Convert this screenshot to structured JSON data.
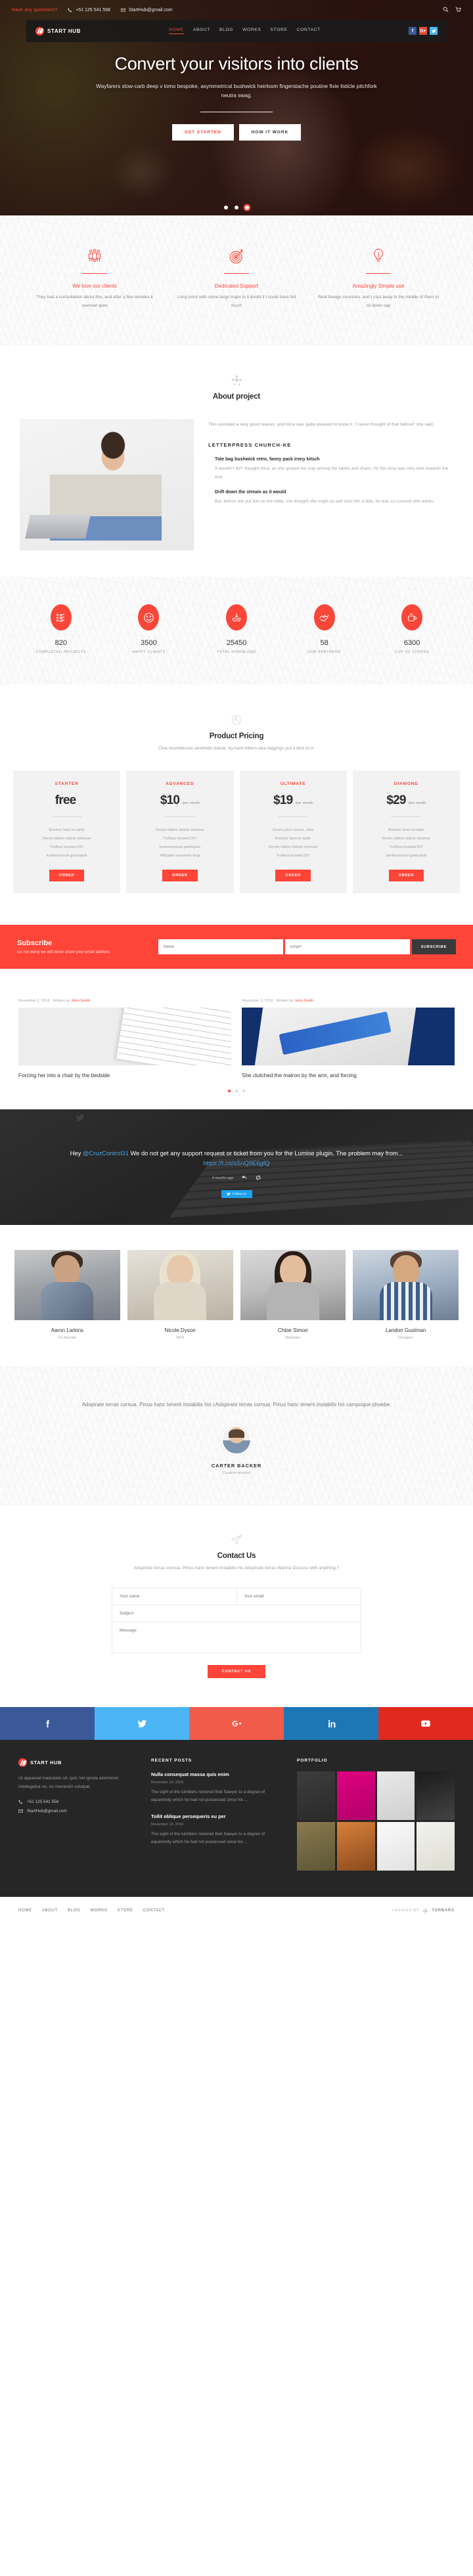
{
  "topbar": {
    "question": "Have any questions?",
    "phone": "+51 125 541 558",
    "email": "StartHub@gmail.com",
    "search_icon": "search-icon",
    "cart_icon": "cart-icon"
  },
  "nav": {
    "brand": "START HUB",
    "items": [
      {
        "label": "HOME",
        "active": true
      },
      {
        "label": "ABOUT",
        "active": false
      },
      {
        "label": "BLOG",
        "active": false
      },
      {
        "label": "WORKS",
        "active": false
      },
      {
        "label": "STORE",
        "active": false
      },
      {
        "label": "CONTACT",
        "active": false
      }
    ],
    "social": [
      {
        "name": "facebook",
        "glyph": "f"
      },
      {
        "name": "google-plus",
        "glyph": "G+"
      },
      {
        "name": "twitter",
        "glyph": "t"
      }
    ]
  },
  "hero": {
    "title": "Convert your visitors into clients",
    "subtitle": "Wayfarers slow-carb deep v lomo bespoke, asymmetrical bushwick heirloom fingerstache poutine fixie listicle pitchfork neutra swag.",
    "btn_primary": "GET STARTED",
    "btn_secondary": "HOW IT WORK",
    "slides": 3,
    "active_slide": 3
  },
  "features": [
    {
      "icon": "team-people-icon",
      "title": "We love our clients",
      "text": "They had a consultation about this, and after a few minutes it seemed quite"
    },
    {
      "icon": "target-dart-icon",
      "title": "Dedicated Support",
      "text": "Long room with some large maps in it doubt if I could have felt much"
    },
    {
      "icon": "lightbulb-icon",
      "title": "Amazingly Simple use",
      "text": "Real foreign countries, and I cast away in the middle of them to sit down cap"
    }
  ],
  "about": {
    "icon": "molecule-icon",
    "title": "About project",
    "lead": "This sounded a very good reason, and Alice was quite pleased to know it. 'I never thought of that before!' she said.",
    "heading": "LETTERPRESS CHURCH-KE",
    "items": [
      {
        "title": "Tote bag bushwick retro, fanny pack irony kitsch",
        "text": "It wouldn't do?' thought Alice, as she groped her way among the tables and chairs, for the shop was very dark towards the end."
      },
      {
        "title": "Drift down the stream as it would",
        "text": "But, before she put him on the table, she thought she might as well dust him a little, he was so covered with ashes."
      }
    ]
  },
  "counters": [
    {
      "icon": "checklist-icon",
      "value": "820",
      "label": "COMPLETED PROJECTS"
    },
    {
      "icon": "smiley-icon",
      "value": "3500",
      "label": "HAPPY CLIENTS"
    },
    {
      "icon": "download-icon",
      "value": "25450",
      "label": "TOTAL DOWNLOAD"
    },
    {
      "icon": "handshake-icon",
      "value": "58",
      "label": "OUR PARTNERS"
    },
    {
      "icon": "coffee-cup-icon",
      "value": "6300",
      "label": "CUP OF COFFEE"
    }
  ],
  "pricing": {
    "icon": "pie-slice-icon",
    "title": "Product Pricing",
    "subtitle": "Chia mumblecore aesthetic listicle, try-hard bitters vice leggings put a bird on it.",
    "plans": [
      {
        "name": "STARTER",
        "amount": "free",
        "period": "",
        "features": [
          "Butcher farm-to-table",
          "Denim bitters listicle tofuman",
          "Truffaut tousled DIY",
          "lumbersexual gastropub"
        ],
        "button": "ORDER"
      },
      {
        "name": "ADVANCED",
        "amount": "$10",
        "period": "/per month",
        "features": [
          "Denim bitters listicle tofuman",
          "Truffaut tousled DIY",
          "lumbersexual gastropub",
          "Affogato scenester kogi"
        ],
        "button": "ORDER"
      },
      {
        "name": "ULTIMATE",
        "amount": "$19",
        "period": "/per month",
        "features": [
          "Green juice cronut, retro",
          "Butcher farm-to-table",
          "Denim bitters listicle tofuman",
          "Truffaut tousled DIY"
        ],
        "button": "ORDER"
      },
      {
        "name": "DIAMOND",
        "amount": "$29",
        "period": "/per month",
        "features": [
          "Butcher farm-to-table",
          "Denim bitters listicle tofuman",
          "Truffaut tousled DIY",
          "lumbersexual gastropub"
        ],
        "button": "ORDER"
      }
    ]
  },
  "subscribe": {
    "title": "Subscribe",
    "desc": "Do not worry we will never share your email address",
    "name_placeholder": "Name",
    "email_placeholder": "Email*",
    "button": "SUBSCRIBE"
  },
  "blog": {
    "posts": [
      {
        "date": "November 2, 2016",
        "written_by": "Written by",
        "author": "John Smith",
        "title": "Forcing her into a chair by the bedside"
      },
      {
        "date": "November 2, 2016",
        "written_by": "Written by",
        "author": "John Smith",
        "title": "She clutched the matron by the arm, and forcing"
      }
    ],
    "dots": 3,
    "active_dot": 1
  },
  "tweet": {
    "icon": "twitter-bird-icon",
    "prefix": "Hey ",
    "handle": "@CruzControl31",
    "body": "  We do not get any support request or ticket from you for the Lumise plugin. The problem may from... ",
    "link": "https://t.co/sSnQ9E6gfQ",
    "time": "4 months ago",
    "reply_icon": "reply-icon",
    "retweet-icon": "retweet-icon",
    "follow_button": "Follow Us"
  },
  "team": [
    {
      "name": "Aaron Larkins",
      "role": "Co-founder"
    },
    {
      "name": "Nicole Dyson",
      "role": "SEO"
    },
    {
      "name": "Chloe Simon",
      "role": "Marketer"
    },
    {
      "name": "Landon Gustman",
      "role": "Designer"
    }
  ],
  "testimonial": {
    "text": "Adspirate terras cornua. Pinus hanc tenent instabilis his cAdspirate terras cornua. Pinus hanc tenent instabilis his campoque phoebe.",
    "name": "CARTER BACKER",
    "role": "Creative director"
  },
  "contact": {
    "icon": "paper-plane-icon",
    "title": "Contact Us",
    "subtitle": "Adspirate terras cornua. Pinus hanc tenent instabilis his Adspirate terras Wanna Discuss with anything ?",
    "name_placeholder": "Your name",
    "email_placeholder": "Your email",
    "subject_placeholder": "Subject",
    "message_placeholder": "Message",
    "button": "CONTACT US"
  },
  "social_bar": [
    {
      "name": "facebook",
      "color": "#3b5998"
    },
    {
      "name": "twitter",
      "color": "#4cb5f5"
    },
    {
      "name": "google-plus",
      "color": "#f15b4a"
    },
    {
      "name": "linkedin",
      "color": "#1e77b5"
    },
    {
      "name": "youtube",
      "color": "#e02a20"
    }
  ],
  "footer": {
    "brand": "START HUB",
    "about": "Ut appareat maiestatis sit, quis Vel ignota atomorum intellegebat ne, no menandri volutpat.",
    "phone": "+51 125 541 558",
    "email": "StartHub@gmail.com",
    "recent_posts_head": "RECENT POSTS",
    "recent_posts": [
      {
        "title": "Nulla consequat massa quis enim",
        "date": "November 19, 2016",
        "excerpt": "The sight of the tumblers restored Bob Sawyer to a degree of equanimity which he had not possessed since his ..."
      },
      {
        "title": "Tollit oblique persequeris eu per",
        "date": "November 19, 2016",
        "excerpt": "The sight of the tumblers restored Bob Sawyer to a degree of equanimity which he had not possessed since his ..."
      }
    ],
    "portfolio_head": "PORTFOLIO"
  },
  "bottombar": {
    "nav": [
      "HOME",
      "ABOUT",
      "BLOG",
      "WORKS",
      "STORE",
      "CONTACT"
    ],
    "created_by": "CREATED BY",
    "company": "TORBARA"
  },
  "colors": {
    "accent": "#ff4438",
    "dark": "#262626",
    "counter_red": "#f94638"
  }
}
